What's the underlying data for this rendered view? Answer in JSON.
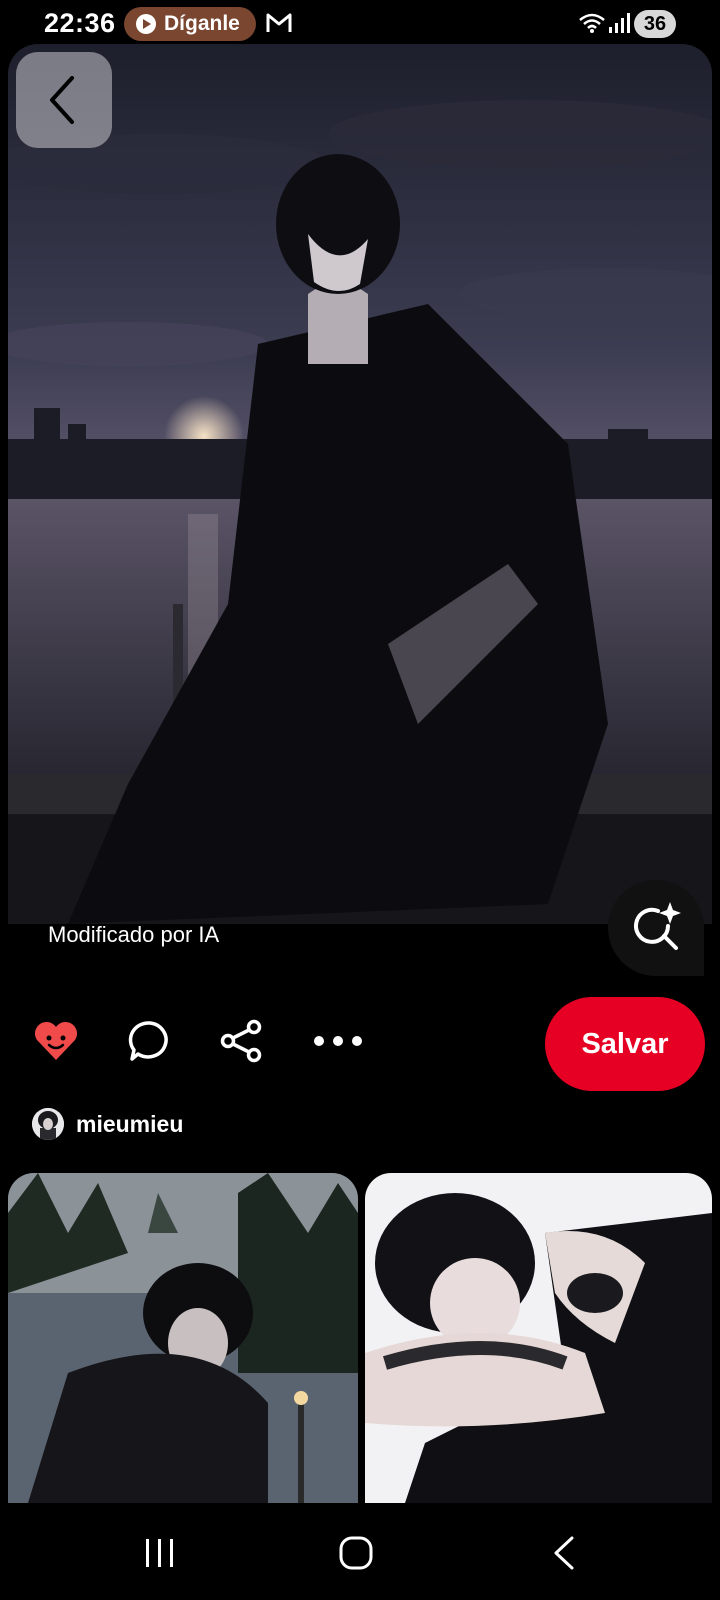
{
  "status_bar": {
    "time": "22:36",
    "notification_pill": "Díganle",
    "battery_level": "36",
    "icons": [
      "play-icon",
      "gmail-icon",
      "wifi-icon",
      "signal-icon",
      "battery-icon"
    ],
    "pill_color": "#7a4630"
  },
  "pin": {
    "ai_label": "Modificado por IA",
    "actions": [
      "heart-icon",
      "comment-icon",
      "share-icon",
      "more-icon"
    ],
    "save_label": "Salvar",
    "save_color": "#e60023",
    "author": "mieumieu"
  },
  "nav_bar": {
    "icons": [
      "recents-icon",
      "home-icon",
      "back-icon"
    ]
  }
}
